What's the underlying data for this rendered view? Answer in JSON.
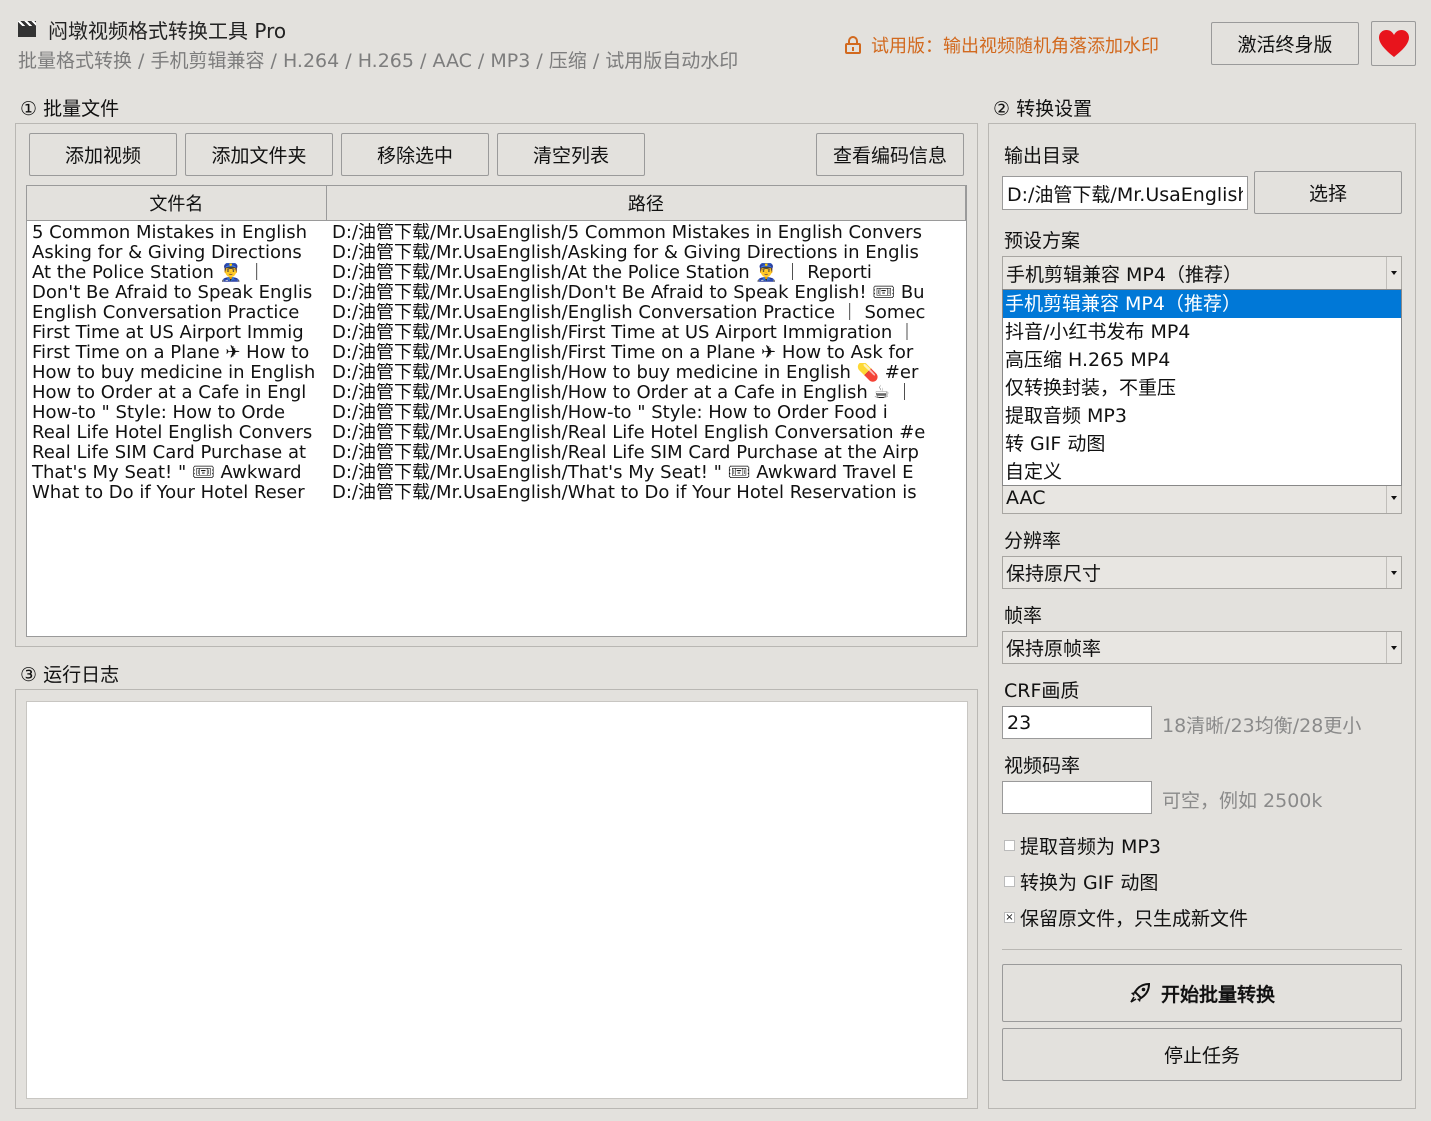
{
  "app": {
    "title": "闷墩视频格式转换工具 Pro",
    "subtitle": "批量格式转换 / 手机剪辑兼容 / H.264 / H.265 / AAC / MP3 / 压缩 / 试用版自动水印",
    "trial_notice": "试用版：输出视频随机角落添加水印",
    "activate_label": "激活终身版",
    "heart_color": "#e8141c"
  },
  "files_section": {
    "title": "① 批量文件",
    "buttons": {
      "add_video": "添加视频",
      "add_folder": "添加文件夹",
      "remove_selected": "移除选中",
      "clear_list": "清空列表",
      "codec_info": "查看编码信息"
    },
    "columns": [
      "文件名",
      "路径"
    ],
    "rows": [
      {
        "name": "5 Common Mistakes in English",
        "path": "D:/油管下载/Mr.UsaEnglish/5 Common Mistakes in English Convers"
      },
      {
        "name": "Asking for & Giving Directions",
        "path": "D:/油管下载/Mr.UsaEnglish/Asking for & Giving Directions in Englis"
      },
      {
        "name": "At the Police Station 👮‍♂️ ｜",
        "path": "D:/油管下载/Mr.UsaEnglish/At the Police Station 👮‍♂️ ｜ Reporti"
      },
      {
        "name": "Don't Be Afraid to Speak Englis",
        "path": "D:/油管下载/Mr.UsaEnglish/Don't Be Afraid to Speak English! 🎟 Bu"
      },
      {
        "name": "English Conversation Practice",
        "path": "D:/油管下载/Mr.UsaEnglish/English Conversation Practice ｜ Somec"
      },
      {
        "name": "First Time at US Airport Immig",
        "path": "D:/油管下载/Mr.UsaEnglish/First Time at US Airport Immigration ｜"
      },
      {
        "name": "First Time on a Plane ✈ How to",
        "path": "D:/油管下载/Mr.UsaEnglish/First Time on a Plane ✈ How to Ask for"
      },
      {
        "name": "How to buy medicine in English",
        "path": "D:/油管下载/Mr.UsaEnglish/How to buy medicine in English 💊 #er"
      },
      {
        "name": "How to Order at a Cafe in Engl",
        "path": "D:/油管下载/Mr.UsaEnglish/How to Order at a Cafe in English ☕ ｜"
      },
      {
        "name": "How-to \" Style: How to Orde",
        "path": "D:/油管下载/Mr.UsaEnglish/How-to \" Style: How to Order Food i"
      },
      {
        "name": "Real Life Hotel English Convers",
        "path": "D:/油管下载/Mr.UsaEnglish/Real Life Hotel English Conversation #e"
      },
      {
        "name": "Real Life SIM Card Purchase at",
        "path": "D:/油管下载/Mr.UsaEnglish/Real Life SIM Card Purchase at the Airp"
      },
      {
        "name": "That's My Seat! \" 🎟 Awkward",
        "path": "D:/油管下载/Mr.UsaEnglish/That's My Seat! \" 🎟 Awkward Travel E"
      },
      {
        "name": "What to Do if Your Hotel Reser",
        "path": "D:/油管下载/Mr.UsaEnglish/What to Do if Your Hotel Reservation is"
      }
    ]
  },
  "log_section": {
    "title": "③ 运行日志"
  },
  "settings": {
    "title": "② 转换设置",
    "output_dir_label": "输出目录",
    "output_dir_value": "D:/油管下载/Mr.UsaEnglish",
    "choose_label": "选择",
    "preset_label": "预设方案",
    "preset_value": "手机剪辑兼容 MP4（推荐）",
    "preset_options": [
      "手机剪辑兼容 MP4（推荐）",
      "抖音/小红书发布 MP4",
      "高压缩 H.265 MP4",
      "仅转换封装，不重压",
      "提取音频 MP3",
      "转 GIF 动图",
      "自定义"
    ],
    "audio_codec_value": "AAC",
    "resolution_label": "分辨率",
    "resolution_value": "保持原尺寸",
    "framerate_label": "帧率",
    "framerate_value": "保持原帧率",
    "crf_label": "CRF画质",
    "crf_value": "23",
    "crf_hint": "18清晰/23均衡/28更小",
    "bitrate_label": "视频码率",
    "bitrate_value": "",
    "bitrate_hint": "可空，例如 2500k",
    "checkboxes": [
      {
        "label": "提取音频为 MP3",
        "checked": false
      },
      {
        "label": "转换为 GIF 动图",
        "checked": false
      },
      {
        "label": "保留原文件，只生成新文件",
        "checked": true
      }
    ],
    "start_label": "开始批量转换",
    "stop_label": "停止任务"
  }
}
